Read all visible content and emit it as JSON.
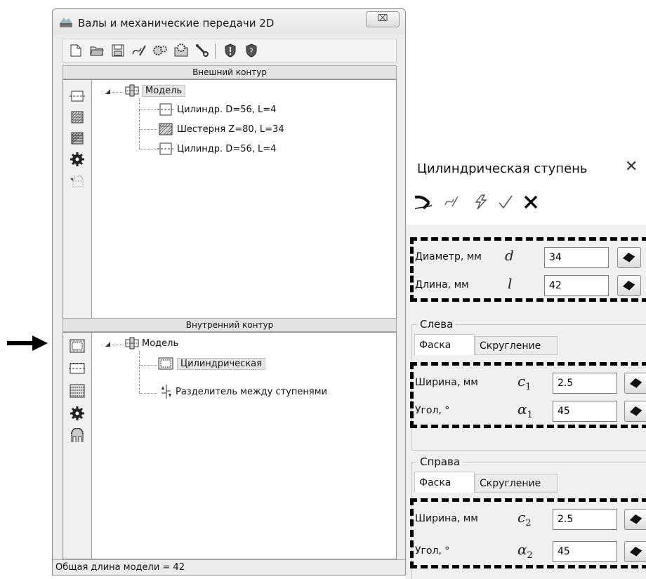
{
  "window": {
    "title": "Валы и механические передачи 2D",
    "close_glyph": "⌧"
  },
  "toolbar": {
    "buttons": [
      "new-file-icon",
      "open-folder-icon",
      "save-icon",
      "edit-curve-icon",
      "gear-settings-icon",
      "gear-param-icon",
      "wrench-icon",
      "shield-check-icon",
      "shield-question-icon"
    ]
  },
  "outer": {
    "header": "Внешний контур",
    "root": "Модель",
    "items": [
      "Цилиндр. D=56, L=4",
      "Шестерня Z=80, L=34",
      "Цилиндр. D=56, L=4"
    ]
  },
  "inner": {
    "header": "Внутренний контур",
    "root": "Модель",
    "items": [
      "Цилиндрическая",
      "Разделитель между ступенями"
    ]
  },
  "status": {
    "text": "Общая длина модели = 42"
  },
  "props": {
    "title": "Цилиндрическая ступень",
    "close": "✕",
    "dims": [
      {
        "label": "Диаметр, мм",
        "sym": "d",
        "sub": "",
        "value": "34"
      },
      {
        "label": "Длина, мм",
        "sym": "l",
        "sub": "",
        "value": "42"
      }
    ],
    "left": {
      "group": "Слева",
      "tabs": [
        "Фаска",
        "Скругление"
      ],
      "rows": [
        {
          "label": "Ширина, мм",
          "sym": "c",
          "sub": "1",
          "value": "2.5"
        },
        {
          "label": "Угол, °",
          "sym": "α",
          "sub": "1",
          "value": "45"
        }
      ]
    },
    "right": {
      "group": "Справа",
      "tabs": [
        "Фаска",
        "Скругление"
      ],
      "rows": [
        {
          "label": "Ширина, мм",
          "sym": "c",
          "sub": "2",
          "value": "2.5"
        },
        {
          "label": "Угол, °",
          "sym": "α",
          "sub": "2",
          "value": "45"
        }
      ]
    }
  }
}
